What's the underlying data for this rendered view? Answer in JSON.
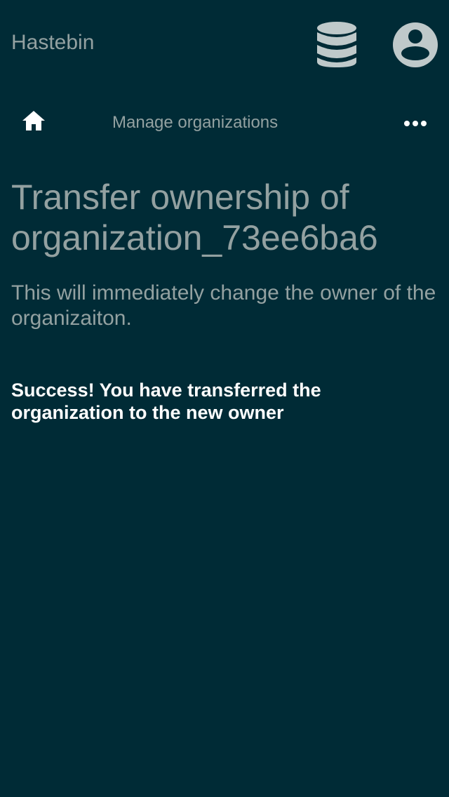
{
  "header": {
    "app_title": "Hastebin",
    "database_icon": "database-icon",
    "user_icon": "user-account-icon"
  },
  "nav": {
    "home_icon": "home-icon",
    "link_label": "Manage organizations",
    "more_icon": "more-horizontal-icon"
  },
  "main": {
    "title": "Transfer ownership of organization_73ee6ba6",
    "description": "This will immediately change the owner of the organizaiton.",
    "success_message": "Success! You have transferred the organization to the new owner"
  },
  "colors": {
    "background": "#002b36",
    "text": "#93a1a1",
    "icon": "#bfc9ca",
    "success_text": "#ffffff"
  }
}
